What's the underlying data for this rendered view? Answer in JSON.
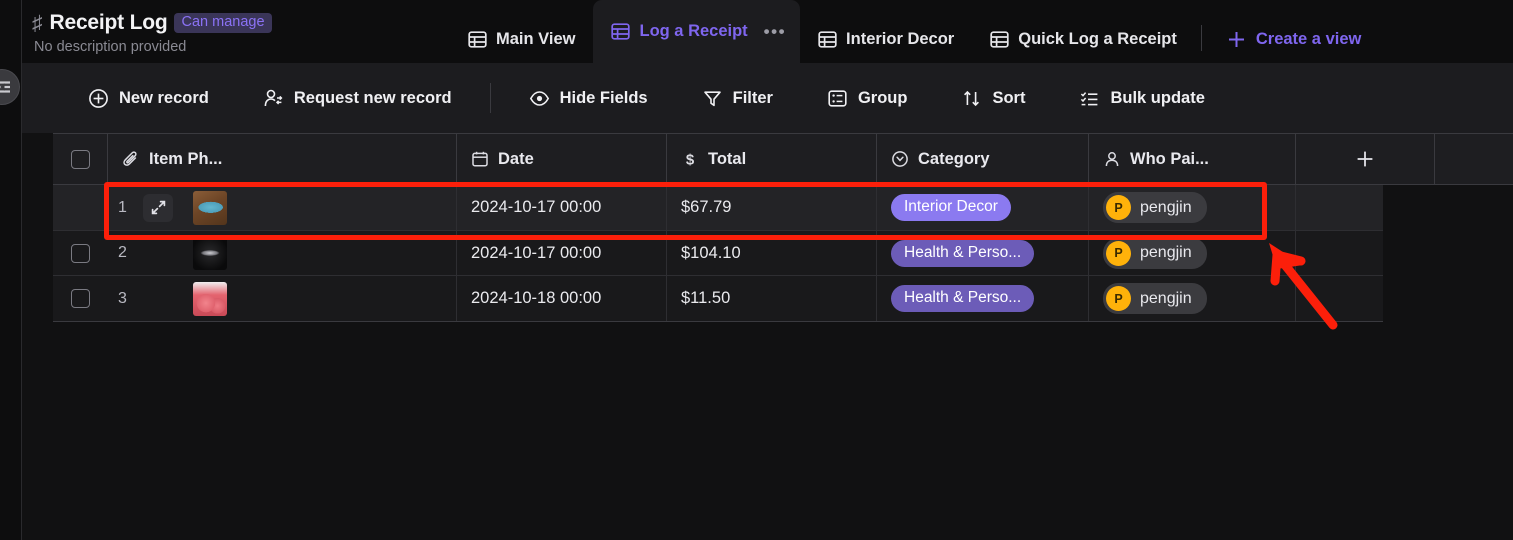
{
  "header": {
    "hash_icon": "hash-icon",
    "title": "Receipt Log",
    "permission_badge": "Can manage",
    "description": "No description provided",
    "tabs": [
      {
        "label": "Main View",
        "icon": "table-icon",
        "active": false
      },
      {
        "label": "Log a Receipt",
        "icon": "table-icon",
        "active": true,
        "overflow": "•••"
      },
      {
        "label": "Interior Decor",
        "icon": "table-icon",
        "active": false
      },
      {
        "label": "Quick Log a Receipt",
        "icon": "table-icon",
        "active": false
      }
    ],
    "create_view": {
      "label": "Create a view",
      "icon": "plus-icon"
    }
  },
  "toolbar": {
    "sidebar_toggle": "sidebar-collapse-icon",
    "items": [
      {
        "label": "New record",
        "icon": "plus-circle-icon"
      },
      {
        "label": "Request new record",
        "icon": "user-request-icon"
      },
      {
        "label": "Hide Fields",
        "icon": "eye-icon"
      },
      {
        "label": "Filter",
        "icon": "funnel-icon"
      },
      {
        "label": "Group",
        "icon": "group-icon"
      },
      {
        "label": "Sort",
        "icon": "sort-arrows-icon"
      },
      {
        "label": "Bulk update",
        "icon": "list-check-icon"
      }
    ]
  },
  "grid": {
    "columns": [
      {
        "label": "Item Ph...",
        "icon": "paperclip-icon"
      },
      {
        "label": "Date",
        "icon": "calendar-icon"
      },
      {
        "label": "Total",
        "icon": "dollar-icon"
      },
      {
        "label": "Category",
        "icon": "circle-chevron-down-icon"
      },
      {
        "label": "Who Pai...",
        "icon": "person-icon"
      }
    ],
    "add_field": "+",
    "rows": [
      {
        "number": "1",
        "thumbnail": "blue-book-on-wood-photo",
        "date": "2024-10-17 00:00",
        "total": "$67.79",
        "category": "Interior Decor",
        "category_color": "#8b7af0",
        "user": "pengjin",
        "user_initial": "P"
      },
      {
        "number": "2",
        "thumbnail": "dark-feather-pen-photo",
        "date": "2024-10-17 00:00",
        "total": "$104.10",
        "category": "Health & Perso...",
        "category_color": "#6c5cb8",
        "user": "pengjin",
        "user_initial": "P"
      },
      {
        "number": "3",
        "thumbnail": "pink-peaches-photo",
        "date": "2024-10-18 00:00",
        "total": "$11.50",
        "category": "Health & Perso...",
        "category_color": "#6c5cb8",
        "user": "pengjin",
        "user_initial": "P"
      }
    ]
  },
  "annotations": {
    "highlight_color": "#fc1f0a",
    "highlight_target": "row-1",
    "arrow_target": "row-1-right-edge"
  }
}
